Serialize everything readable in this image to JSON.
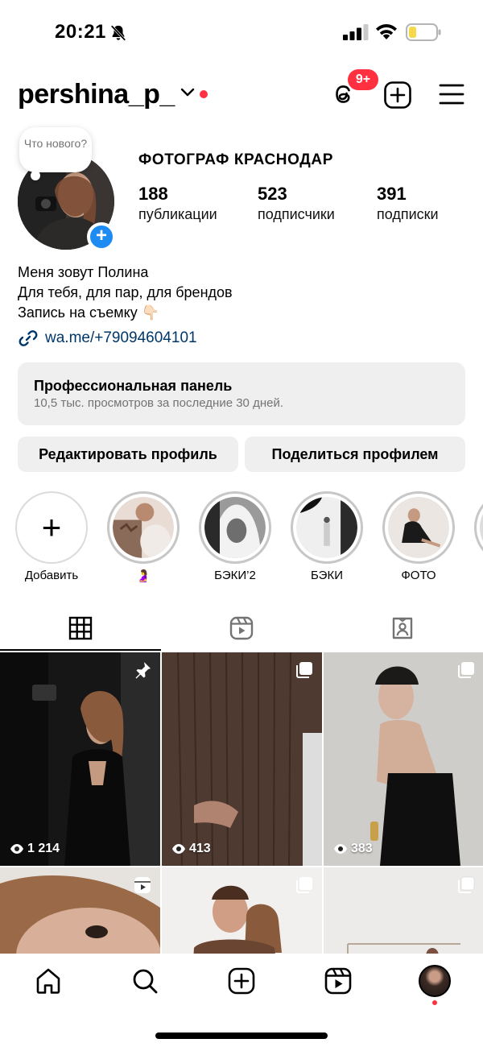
{
  "status_bar": {
    "time": "20:21",
    "icons": [
      "bell-off-icon",
      "signal-icon",
      "wifi-icon",
      "battery-icon"
    ]
  },
  "header": {
    "username": "pershina_p_",
    "threads_badge": "9+",
    "icons": [
      "chevron-down-icon",
      "threads-icon",
      "create-icon",
      "menu-icon"
    ]
  },
  "note": {
    "text": "Что нового?"
  },
  "profile": {
    "name": "ФОТОГРАФ КРАСНОДАР",
    "stats": [
      {
        "value": "188",
        "label": "публикации"
      },
      {
        "value": "523",
        "label": "подписчики"
      },
      {
        "value": "391",
        "label": "подписки"
      }
    ],
    "bio": [
      "Меня зовут Полина",
      "Для тебя, для пар, для брендов",
      "Запись на съемку 👇🏻"
    ],
    "link": "wa.me/+79094604101"
  },
  "pro_panel": {
    "title": "Профессиональная панель",
    "subtitle": "10,5 тыс. просмотров за последние 30 дней."
  },
  "buttons": {
    "edit": "Редактировать профиль",
    "share": "Поделиться профилем"
  },
  "highlights": [
    {
      "label": "Добавить"
    },
    {
      "label": "🤰"
    },
    {
      "label": "БЭКИ’2"
    },
    {
      "label": "БЭКИ"
    },
    {
      "label": "ФОТО"
    }
  ],
  "tabs": [
    "grid-icon",
    "reels-icon",
    "tagged-icon"
  ],
  "posts": [
    {
      "views": "1 214",
      "badge": "pin-icon"
    },
    {
      "views": "413",
      "badge": "carousel-icon"
    },
    {
      "views": "383",
      "badge": "carousel-icon"
    },
    {
      "views": "",
      "badge": "reels-icon"
    },
    {
      "views": "",
      "badge": "carousel-icon"
    },
    {
      "views": "",
      "badge": "carousel-icon"
    }
  ],
  "bottom_nav": [
    "home-icon",
    "search-icon",
    "create-icon",
    "reels-icon",
    "profile-avatar"
  ],
  "colors": {
    "accent_red": "#ff3040",
    "link_blue": "#00376b",
    "plus_blue": "#1d8bf1",
    "panel_gray": "#efefef"
  }
}
